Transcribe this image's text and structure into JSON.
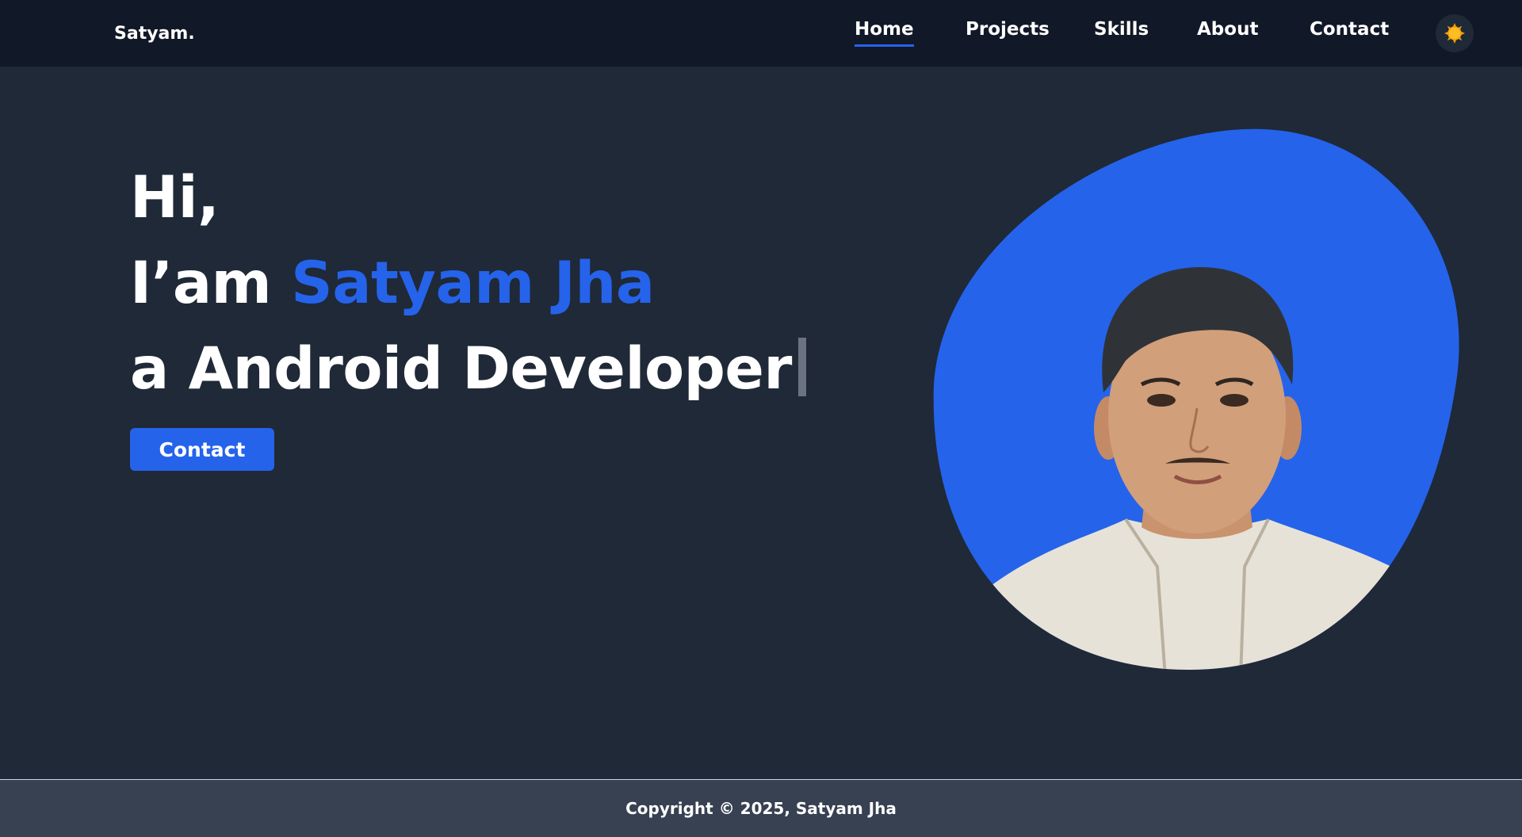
{
  "header": {
    "brand": "Satyam.",
    "nav": [
      {
        "label": "Home",
        "active": true
      },
      {
        "label": "Projects",
        "active": false
      },
      {
        "label": "Skills",
        "active": false
      },
      {
        "label": "About",
        "active": false
      },
      {
        "label": "Contact",
        "active": false
      }
    ],
    "theme_toggle_icon": "sun-icon"
  },
  "hero": {
    "greeting": "Hi,",
    "intro_prefix": "I’am ",
    "name": "Satyam Jha",
    "role_line": "a Android Developer",
    "contact_button": "Contact",
    "portrait_icon": "profile-photo"
  },
  "footer": {
    "copyright": "Copyright © 2025, Satyam Jha"
  },
  "colors": {
    "accent": "#2563eb",
    "background": "#1f2937",
    "navbar": "#111827",
    "footer": "#374151",
    "sun": "#f59e0b"
  }
}
